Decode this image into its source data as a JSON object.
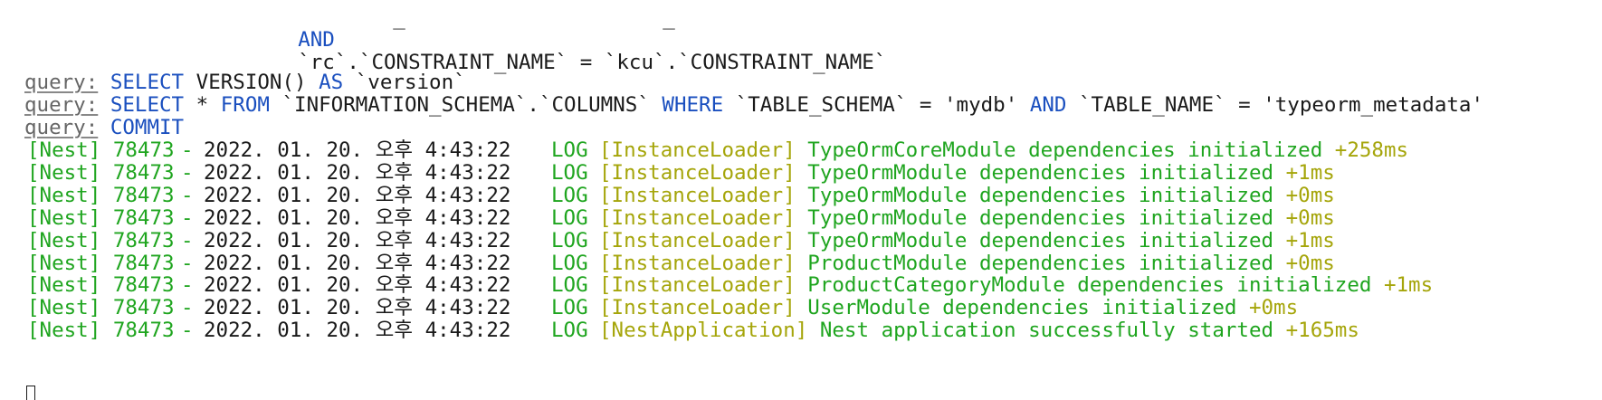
{
  "sql_tail": {
    "and_keyword": "AND",
    "constraint_expr": "`rc`.`CONSTRAINT_NAME` = `kcu`.`CONSTRAINT_NAME`"
  },
  "queries": [
    {
      "label": "query:",
      "parts": [
        {
          "t": "SELECT",
          "c": "kw"
        },
        {
          "t": " VERSION() ",
          "c": "plain"
        },
        {
          "t": "AS",
          "c": "kw"
        },
        {
          "t": " `version`",
          "c": "plain"
        }
      ]
    },
    {
      "label": "query:",
      "parts": [
        {
          "t": "SELECT",
          "c": "kw"
        },
        {
          "t": " * ",
          "c": "plain"
        },
        {
          "t": "FROM",
          "c": "kw"
        },
        {
          "t": " `INFORMATION_SCHEMA`.`COLUMNS` ",
          "c": "plain"
        },
        {
          "t": "WHERE",
          "c": "kw"
        },
        {
          "t": " `TABLE_SCHEMA` = 'mydb' ",
          "c": "plain"
        },
        {
          "t": "AND",
          "c": "kw"
        },
        {
          "t": " `TABLE_NAME` = 'typeorm_metadata'",
          "c": "plain"
        }
      ]
    },
    {
      "label": "query:",
      "parts": [
        {
          "t": "COMMIT",
          "c": "kw"
        }
      ]
    }
  ],
  "logs": [
    {
      "prefix": "[Nest] 78473",
      "dash": "-",
      "timestamp": "2022. 01. 20. 오후 4:43:22",
      "level": "LOG",
      "context": "[InstanceLoader]",
      "message": "TypeOrmCoreModule dependencies initialized",
      "elapsed": "+258ms"
    },
    {
      "prefix": "[Nest] 78473",
      "dash": "-",
      "timestamp": "2022. 01. 20. 오후 4:43:22",
      "level": "LOG",
      "context": "[InstanceLoader]",
      "message": "TypeOrmModule dependencies initialized",
      "elapsed": "+1ms"
    },
    {
      "prefix": "[Nest] 78473",
      "dash": "-",
      "timestamp": "2022. 01. 20. 오후 4:43:22",
      "level": "LOG",
      "context": "[InstanceLoader]",
      "message": "TypeOrmModule dependencies initialized",
      "elapsed": "+0ms"
    },
    {
      "prefix": "[Nest] 78473",
      "dash": "-",
      "timestamp": "2022. 01. 20. 오후 4:43:22",
      "level": "LOG",
      "context": "[InstanceLoader]",
      "message": "TypeOrmModule dependencies initialized",
      "elapsed": "+0ms"
    },
    {
      "prefix": "[Nest] 78473",
      "dash": "-",
      "timestamp": "2022. 01. 20. 오후 4:43:22",
      "level": "LOG",
      "context": "[InstanceLoader]",
      "message": "TypeOrmModule dependencies initialized",
      "elapsed": "+1ms"
    },
    {
      "prefix": "[Nest] 78473",
      "dash": "-",
      "timestamp": "2022. 01. 20. 오후 4:43:22",
      "level": "LOG",
      "context": "[InstanceLoader]",
      "message": "ProductModule dependencies initialized",
      "elapsed": "+0ms"
    },
    {
      "prefix": "[Nest] 78473",
      "dash": "-",
      "timestamp": "2022. 01. 20. 오후 4:43:22",
      "level": "LOG",
      "context": "[InstanceLoader]",
      "message": "ProductCategoryModule dependencies initialized",
      "elapsed": "+1ms"
    },
    {
      "prefix": "[Nest] 78473",
      "dash": "-",
      "timestamp": "2022. 01. 20. 오후 4:43:22",
      "level": "LOG",
      "context": "[InstanceLoader]",
      "message": "UserModule dependencies initialized",
      "elapsed": "+0ms"
    },
    {
      "prefix": "[Nest] 78473",
      "dash": "-",
      "timestamp": "2022. 01. 20. 오후 4:43:22",
      "level": "LOG",
      "context": "[NestApplication]",
      "message": "Nest application successfully started",
      "elapsed": "+165ms"
    }
  ],
  "colors": {
    "keyword": "#1a4fbf",
    "log_green": "#1fa51f",
    "context_olive": "#a5a50a",
    "query_label": "#666666",
    "text": "#1a1a1a"
  },
  "cursor_icon": "terminal-block-cursor"
}
